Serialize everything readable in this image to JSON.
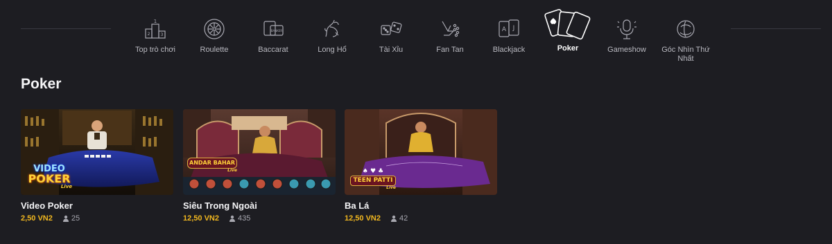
{
  "categories": [
    {
      "label": "Top trò chơi",
      "icon": "podium-icon",
      "active": false
    },
    {
      "label": "Roulette",
      "icon": "roulette-wheel-icon",
      "active": false
    },
    {
      "label": "Baccarat",
      "icon": "baccarat-cards-icon",
      "active": false
    },
    {
      "label": "Long Hổ",
      "icon": "dragon-tiger-icon",
      "active": false
    },
    {
      "label": "Tài Xỉu",
      "icon": "dice-icon",
      "active": false
    },
    {
      "label": "Fan Tan",
      "icon": "fan-tan-hand-icon",
      "active": false
    },
    {
      "label": "Blackjack",
      "icon": "blackjack-cards-icon",
      "active": false
    },
    {
      "label": "Poker",
      "icon": "poker-cards-icon",
      "active": true
    },
    {
      "label": "Gameshow",
      "icon": "microphone-icon",
      "active": false
    },
    {
      "label": "Góc Nhìn Thứ Nhất",
      "icon": "first-person-view-icon",
      "active": false
    }
  ],
  "section": {
    "title": "Poker"
  },
  "games": [
    {
      "name": "Video Poker",
      "bet": "2,50 VN2",
      "players": "25",
      "logo_line1": "VIDEO",
      "logo_line2": "POKER",
      "logo_sub": "Live"
    },
    {
      "name": "Siêu Trong Ngoài",
      "bet": "12,50 VN2",
      "players": "435",
      "logo_line1": "ANDAR BAHAR",
      "logo_sub": "Live"
    },
    {
      "name": "Ba Lá",
      "bet": "12,50 VN2",
      "players": "42",
      "logo_line1": "TEEN PATTI",
      "logo_sub": "Live"
    }
  ],
  "colors": {
    "accent": "#f2b81f",
    "background": "#1d1d22"
  }
}
